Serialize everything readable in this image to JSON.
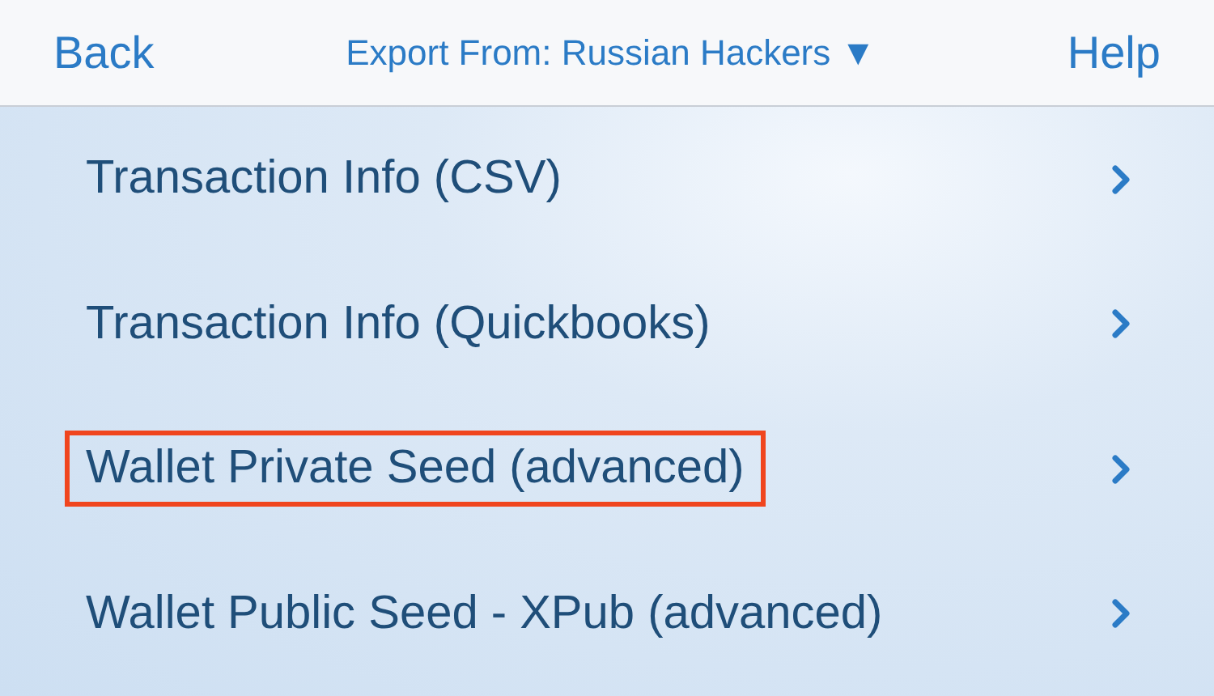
{
  "header": {
    "back": "Back",
    "title": "Export From: Russian Hackers ▼",
    "help": "Help"
  },
  "items": [
    {
      "label": "Transaction Info (CSV)",
      "highlighted": false
    },
    {
      "label": "Transaction Info (Quickbooks)",
      "highlighted": false
    },
    {
      "label": "Wallet Private Seed (advanced)",
      "highlighted": true
    },
    {
      "label": "Wallet Public Seed - XPub (advanced)",
      "highlighted": false
    }
  ]
}
